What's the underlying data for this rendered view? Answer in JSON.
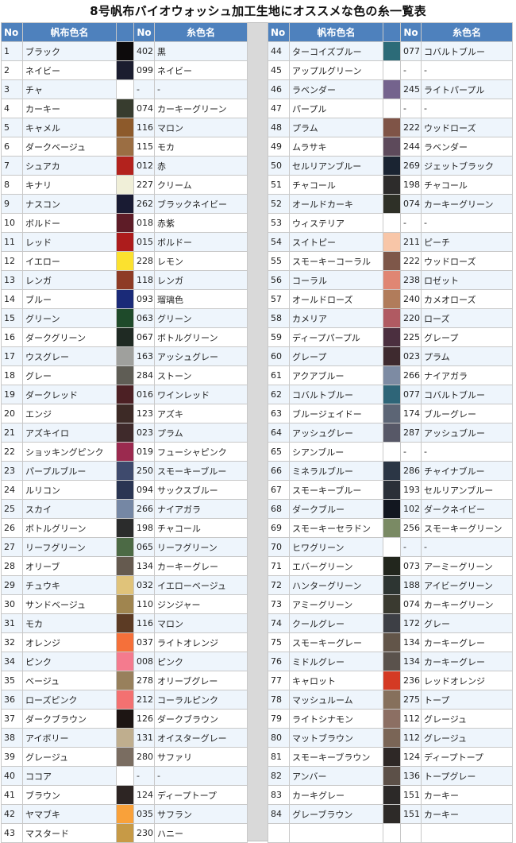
{
  "title": "8号帆布バイオウォッシュ加工生地にオススメな色の糸一覧表",
  "headers": {
    "no": "No",
    "fabric": "帆布色名",
    "thread_no": "No",
    "thread": "糸色名"
  },
  "left_rows": [
    {
      "no": "1",
      "fabric": "ブラック",
      "color": "#0d0b0c",
      "tno": "402",
      "thread": "黒"
    },
    {
      "no": "2",
      "fabric": "ネイビー",
      "color": "#1b1d2f",
      "tno": "099",
      "thread": "ネイビー"
    },
    {
      "no": "3",
      "fabric": "チャ",
      "color": "#ffffff",
      "tno": "-",
      "thread": "-"
    },
    {
      "no": "4",
      "fabric": "カーキー",
      "color": "#373c2e",
      "tno": "074",
      "thread": "カーキーグリーン"
    },
    {
      "no": "5",
      "fabric": "キャメル",
      "color": "#8d5a2b",
      "tno": "116",
      "thread": "マロン"
    },
    {
      "no": "6",
      "fabric": "ダークベージュ",
      "color": "#9b6e43",
      "tno": "115",
      "thread": "モカ"
    },
    {
      "no": "7",
      "fabric": "シュアカ",
      "color": "#b3221d",
      "tno": "012",
      "thread": "赤"
    },
    {
      "no": "8",
      "fabric": "キナリ",
      "color": "#f0efd8",
      "tno": "227",
      "thread": "クリーム"
    },
    {
      "no": "9",
      "fabric": "ナスコン",
      "color": "#191b33",
      "tno": "262",
      "thread": "ブラックネイビー"
    },
    {
      "no": "10",
      "fabric": "ボルドー",
      "color": "#5e1c27",
      "tno": "018",
      "thread": "赤紫"
    },
    {
      "no": "11",
      "fabric": "レッド",
      "color": "#ad1c1c",
      "tno": "015",
      "thread": "ボルドー"
    },
    {
      "no": "12",
      "fabric": "イエロー",
      "color": "#fbe12f",
      "tno": "228",
      "thread": "レモン"
    },
    {
      "no": "13",
      "fabric": "レンガ",
      "color": "#8e3b25",
      "tno": "118",
      "thread": "レンガ"
    },
    {
      "no": "14",
      "fabric": "ブルー",
      "color": "#1a2a78",
      "tno": "093",
      "thread": "瑠璃色"
    },
    {
      "no": "15",
      "fabric": "グリーン",
      "color": "#1e4a2a",
      "tno": "063",
      "thread": "グリーン"
    },
    {
      "no": "16",
      "fabric": "ダークグリーン",
      "color": "#1f2a23",
      "tno": "067",
      "thread": "ボトルグリーン"
    },
    {
      "no": "17",
      "fabric": "ウスグレー",
      "color": "#9fa09d",
      "tno": "163",
      "thread": "アッシュグレー"
    },
    {
      "no": "18",
      "fabric": "グレー",
      "color": "#5f5d55",
      "tno": "284",
      "thread": "ストーン"
    },
    {
      "no": "19",
      "fabric": "ダークレッド",
      "color": "#4c2024",
      "tno": "016",
      "thread": "ワインレッド"
    },
    {
      "no": "20",
      "fabric": "エンジ",
      "color": "#3d2a26",
      "tno": "123",
      "thread": "アズキ"
    },
    {
      "no": "21",
      "fabric": "アズキイロ",
      "color": "#3f2a2b",
      "tno": "023",
      "thread": "プラム"
    },
    {
      "no": "22",
      "fabric": "ショッキングピンク",
      "color": "#9b2a4f",
      "tno": "019",
      "thread": "フューシャピンク"
    },
    {
      "no": "23",
      "fabric": "パープルブルー",
      "color": "#3e4a6d",
      "tno": "250",
      "thread": "スモーキーブルー"
    },
    {
      "no": "24",
      "fabric": "ルリコン",
      "color": "#2a3553",
      "tno": "094",
      "thread": "サックスブルー"
    },
    {
      "no": "25",
      "fabric": "スカイ",
      "color": "#7587a4",
      "tno": "266",
      "thread": "ナイアガラ"
    },
    {
      "no": "26",
      "fabric": "ボトルグリーン",
      "color": "#2b2c2c",
      "tno": "198",
      "thread": "チャコール"
    },
    {
      "no": "27",
      "fabric": "リーフグリーン",
      "color": "#4c6a45",
      "tno": "065",
      "thread": "リーフグリーン"
    },
    {
      "no": "28",
      "fabric": "オリーブ",
      "color": "#655a4f",
      "tno": "134",
      "thread": "カーキーグレー"
    },
    {
      "no": "29",
      "fabric": "チュウキ",
      "color": "#e0c37a",
      "tno": "032",
      "thread": "イエローベージュ"
    },
    {
      "no": "30",
      "fabric": "サンドベージュ",
      "color": "#a0854f",
      "tno": "110",
      "thread": "ジンジャー"
    },
    {
      "no": "31",
      "fabric": "モカ",
      "color": "#5c3b24",
      "tno": "116",
      "thread": "マロン"
    },
    {
      "no": "32",
      "fabric": "オレンジ",
      "color": "#f5703a",
      "tno": "037",
      "thread": "ライトオレンジ"
    },
    {
      "no": "34",
      "fabric": "ピンク",
      "color": "#f47b8e",
      "tno": "008",
      "thread": "ピンク"
    },
    {
      "no": "35",
      "fabric": "ベージュ",
      "color": "#98805c",
      "tno": "278",
      "thread": "オリーブグレー"
    },
    {
      "no": "36",
      "fabric": "ローズピンク",
      "color": "#f37171",
      "tno": "212",
      "thread": "コーラルピンク"
    },
    {
      "no": "37",
      "fabric": "ダークブラウン",
      "color": "#1d1513",
      "tno": "126",
      "thread": "ダークブラウン"
    },
    {
      "no": "38",
      "fabric": "アイボリー",
      "color": "#bfae8e",
      "tno": "131",
      "thread": "オイスターグレー"
    },
    {
      "no": "39",
      "fabric": "グレージュ",
      "color": "#7a6d61",
      "tno": "280",
      "thread": "サファリ"
    },
    {
      "no": "40",
      "fabric": "ココア",
      "color": "#ffffff",
      "tno": "-",
      "thread": "-"
    },
    {
      "no": "41",
      "fabric": "ブラウン",
      "color": "#2d2523",
      "tno": "124",
      "thread": "ディープトープ"
    },
    {
      "no": "42",
      "fabric": "ヤマブキ",
      "color": "#f9a13a",
      "tno": "035",
      "thread": "サフラン"
    },
    {
      "no": "43",
      "fabric": "マスタード",
      "color": "#c79a46",
      "tno": "230",
      "thread": "ハニー"
    }
  ],
  "right_rows": [
    {
      "no": "44",
      "fabric": "ターコイズブルー",
      "color": "#2c6b78",
      "tno": "077",
      "thread": "コバルトブルー"
    },
    {
      "no": "45",
      "fabric": "アップルグリーン",
      "color": "#ffffff",
      "tno": "-",
      "thread": "-"
    },
    {
      "no": "46",
      "fabric": "ラベンダー",
      "color": "#74638d",
      "tno": "245",
      "thread": "ライトパープル"
    },
    {
      "no": "47",
      "fabric": "パープル",
      "color": "#ffffff",
      "tno": "-",
      "thread": "-"
    },
    {
      "no": "48",
      "fabric": "プラム",
      "color": "#7f5447",
      "tno": "222",
      "thread": "ウッドローズ"
    },
    {
      "no": "49",
      "fabric": "ムラサキ",
      "color": "#5d4a5b",
      "tno": "244",
      "thread": "ラベンダー"
    },
    {
      "no": "50",
      "fabric": "セルリアンブルー",
      "color": "#1a2432",
      "tno": "269",
      "thread": "ジェットブラック"
    },
    {
      "no": "51",
      "fabric": "チャコール",
      "color": "#2d2c2b",
      "tno": "198",
      "thread": "チャコール"
    },
    {
      "no": "52",
      "fabric": "オールドカーキ",
      "color": "#2e3027",
      "tno": "074",
      "thread": "カーキーグリーン"
    },
    {
      "no": "53",
      "fabric": "ウィステリア",
      "color": "#ffffff",
      "tno": "-",
      "thread": "-"
    },
    {
      "no": "54",
      "fabric": "スイトピー",
      "color": "#f8c6a8",
      "tno": "211",
      "thread": "ピーチ"
    },
    {
      "no": "55",
      "fabric": "スモーキーコーラル",
      "color": "#7e5749",
      "tno": "222",
      "thread": "ウッドローズ"
    },
    {
      "no": "56",
      "fabric": "コーラル",
      "color": "#e08673",
      "tno": "238",
      "thread": "ロゼット"
    },
    {
      "no": "57",
      "fabric": "オールドローズ",
      "color": "#b17c5b",
      "tno": "240",
      "thread": "カメオローズ"
    },
    {
      "no": "58",
      "fabric": "カメリア",
      "color": "#b05a62",
      "tno": "220",
      "thread": "ローズ"
    },
    {
      "no": "59",
      "fabric": "ディープパープル",
      "color": "#4b2f3f",
      "tno": "225",
      "thread": "グレープ"
    },
    {
      "no": "60",
      "fabric": "グレープ",
      "color": "#3e2a2f",
      "tno": "023",
      "thread": "プラム"
    },
    {
      "no": "61",
      "fabric": "アクアブルー",
      "color": "#7d8ba3",
      "tno": "266",
      "thread": "ナイアガラ"
    },
    {
      "no": "62",
      "fabric": "コバルトブルー",
      "color": "#2e6578",
      "tno": "077",
      "thread": "コバルトブルー"
    },
    {
      "no": "63",
      "fabric": "ブルージェイドー",
      "color": "#5c6575",
      "tno": "174",
      "thread": "ブルーグレー"
    },
    {
      "no": "64",
      "fabric": "アッシュグレー",
      "color": "#575867",
      "tno": "287",
      "thread": "アッシュブルー"
    },
    {
      "no": "65",
      "fabric": "シアンブルー",
      "color": "#ffffff",
      "tno": "-",
      "thread": "-"
    },
    {
      "no": "66",
      "fabric": "ミネラルブルー",
      "color": "#2b3645",
      "tno": "286",
      "thread": "チャイナブルー"
    },
    {
      "no": "67",
      "fabric": "スモーキーブルー",
      "color": "#2b3038",
      "tno": "193",
      "thread": "セルリアンブルー"
    },
    {
      "no": "68",
      "fabric": "ダークブルー",
      "color": "#121720",
      "tno": "102",
      "thread": "ダークネイビー"
    },
    {
      "no": "69",
      "fabric": "スモーキーセラドン",
      "color": "#7a8a64",
      "tno": "256",
      "thread": "スモーキーグリーン"
    },
    {
      "no": "70",
      "fabric": "ヒワグリーン",
      "color": "#ffffff",
      "tno": "-",
      "thread": "-"
    },
    {
      "no": "71",
      "fabric": "エバーグリーン",
      "color": "#22261d",
      "tno": "073",
      "thread": "アーミーグリーン"
    },
    {
      "no": "72",
      "fabric": "ハンターグリーン",
      "color": "#2d3532",
      "tno": "188",
      "thread": "アイビーグリーン"
    },
    {
      "no": "73",
      "fabric": "アミーグリーン",
      "color": "#3a3a30",
      "tno": "074",
      "thread": "カーキーグリーン"
    },
    {
      "no": "74",
      "fabric": "クールグレー",
      "color": "#3d3f45",
      "tno": "172",
      "thread": "グレー"
    },
    {
      "no": "75",
      "fabric": "スモーキーグレー",
      "color": "#625549",
      "tno": "134",
      "thread": "カーキーグレー"
    },
    {
      "no": "76",
      "fabric": "ミドルグレー",
      "color": "#5a524c",
      "tno": "134",
      "thread": "カーキーグレー"
    },
    {
      "no": "77",
      "fabric": "キャロット",
      "color": "#d43a24",
      "tno": "236",
      "thread": "レッドオレンジ"
    },
    {
      "no": "78",
      "fabric": "マッシュルーム",
      "color": "#86705c",
      "tno": "275",
      "thread": "トープ"
    },
    {
      "no": "79",
      "fabric": "ライトシナモン",
      "color": "#8c6f63",
      "tno": "112",
      "thread": "グレージュ"
    },
    {
      "no": "80",
      "fabric": "マットブラウン",
      "color": "#7a6556",
      "tno": "112",
      "thread": "グレージュ"
    },
    {
      "no": "81",
      "fabric": "スモーキーブラウン",
      "color": "#2e2826",
      "tno": "124",
      "thread": "ディープトープ"
    },
    {
      "no": "82",
      "fabric": "アンバー",
      "color": "#5c5048",
      "tno": "136",
      "thread": "トープグレー"
    },
    {
      "no": "83",
      "fabric": "カーキグレー",
      "color": "#2c2928",
      "tno": "151",
      "thread": "カーキー"
    },
    {
      "no": "84",
      "fabric": "グレーブラウン",
      "color": "#2d2a28",
      "tno": "151",
      "thread": "カーキー"
    }
  ]
}
